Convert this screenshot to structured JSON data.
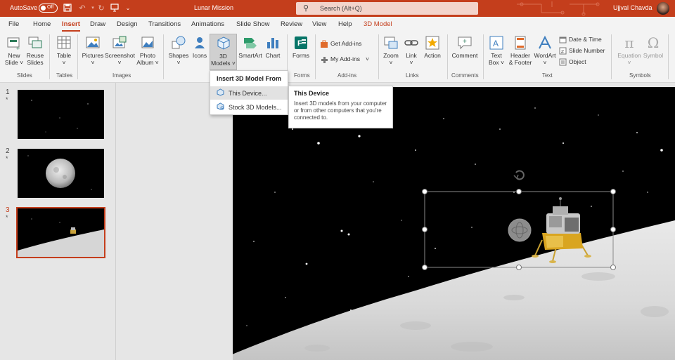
{
  "titlebar": {
    "autosave_label": "AutoSave",
    "autosave_state": "Off",
    "document_title": "Lunar Mission",
    "search_placeholder": "Search (Alt+Q)",
    "user_name": "Ujjval Chavda",
    "bg_color": "#c43e1c"
  },
  "tabs": [
    {
      "label": "File"
    },
    {
      "label": "Home"
    },
    {
      "label": "Insert",
      "active": true
    },
    {
      "label": "Draw"
    },
    {
      "label": "Design"
    },
    {
      "label": "Transitions"
    },
    {
      "label": "Animations"
    },
    {
      "label": "Slide Show"
    },
    {
      "label": "Review"
    },
    {
      "label": "View"
    },
    {
      "label": "Help"
    },
    {
      "label": "3D Model",
      "contextual": true
    }
  ],
  "ribbon": {
    "slides": {
      "group": "Slides",
      "new_slide": [
        "New",
        "Slide"
      ],
      "reuse_slides": [
        "Reuse",
        "Slides"
      ]
    },
    "tables": {
      "group": "Tables",
      "table": "Table"
    },
    "images": {
      "group": "Images",
      "pictures": "Pictures",
      "screenshot": "Screenshot",
      "photo_album": [
        "Photo",
        "Album"
      ]
    },
    "illustrations": {
      "shapes": "Shapes",
      "icons": "Icons",
      "models3d": [
        "3D",
        "Models"
      ],
      "smartart": "SmartArt",
      "chart": "Chart"
    },
    "forms": {
      "group": "Forms",
      "forms": "Forms"
    },
    "addins": {
      "group": "Add-ins",
      "get_addins": "Get Add-ins",
      "my_addins": "My Add-ins"
    },
    "links": {
      "group": "Links",
      "zoom": "Zoom",
      "link": "Link",
      "action": "Action"
    },
    "comments": {
      "group": "Comments",
      "comment": "Comment"
    },
    "text": {
      "group": "Text",
      "text_box": [
        "Text",
        "Box"
      ],
      "header_footer": [
        "Header",
        "& Footer"
      ],
      "wordart": "WordArt",
      "date_time": "Date & Time",
      "slide_number": "Slide Number",
      "object": "Object"
    },
    "symbols": {
      "group": "Symbols",
      "equation": "Equation",
      "symbol": "Symbol"
    }
  },
  "menu_3d": {
    "header": "Insert 3D Model From",
    "items": [
      {
        "label": "This Device...",
        "highlighted": true
      },
      {
        "label": "Stock 3D Models..."
      }
    ]
  },
  "tooltip": {
    "title": "This Device",
    "description": "Insert 3D models from your computer or from other computers that you're connected to."
  },
  "slides": [
    {
      "number": "1",
      "marker": "*"
    },
    {
      "number": "2",
      "marker": "*"
    },
    {
      "number": "3",
      "marker": "*",
      "selected": true
    }
  ],
  "colors": {
    "accent": "#c43e1c",
    "ribbon_bg": "#f3f3f3",
    "pane_bg": "#e6e6e6"
  }
}
